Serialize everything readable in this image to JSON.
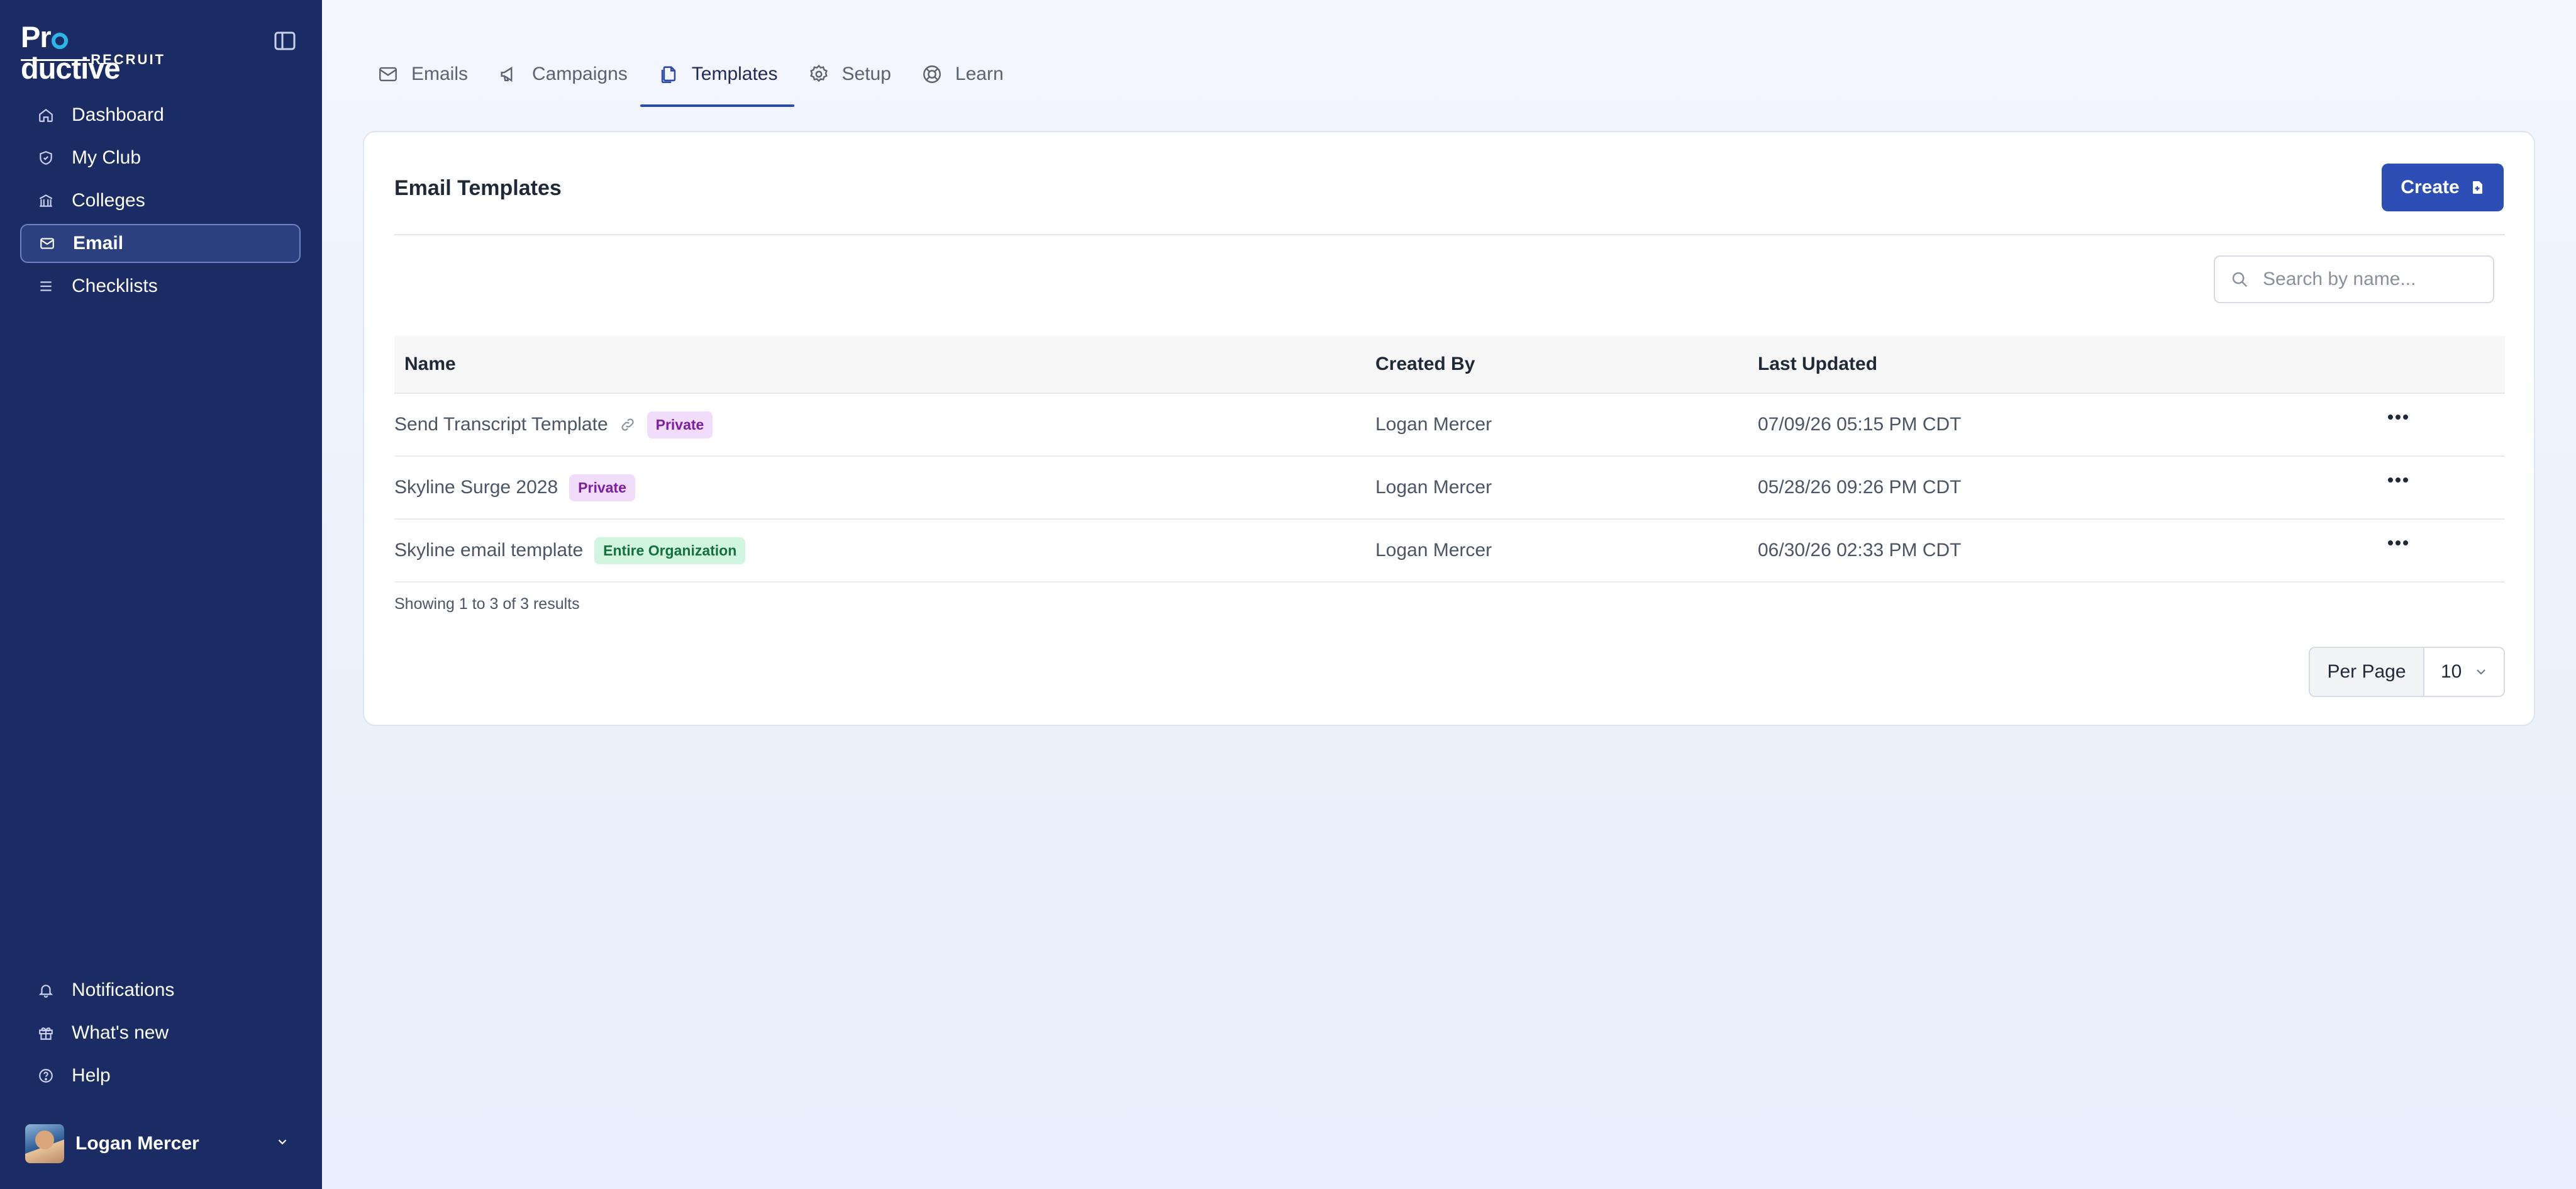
{
  "brand": {
    "name_pre": "Pr",
    "name_post": "ductive",
    "sub": "RECRUIT"
  },
  "sidebar": {
    "items": [
      {
        "label": "Dashboard",
        "icon": "home-icon"
      },
      {
        "label": "My Club",
        "icon": "shield-icon"
      },
      {
        "label": "Colleges",
        "icon": "building-icon"
      },
      {
        "label": "Email",
        "icon": "mail-icon",
        "active": true
      },
      {
        "label": "Checklists",
        "icon": "list-icon"
      }
    ],
    "bottom_items": [
      {
        "label": "Notifications",
        "icon": "bell-icon"
      },
      {
        "label": "What's new",
        "icon": "gift-icon"
      },
      {
        "label": "Help",
        "icon": "help-icon"
      }
    ],
    "user": {
      "name": "Logan Mercer"
    }
  },
  "tabs": [
    {
      "label": "Emails",
      "icon": "mail-icon"
    },
    {
      "label": "Campaigns",
      "icon": "megaphone-icon"
    },
    {
      "label": "Templates",
      "icon": "copy-icon",
      "active": true
    },
    {
      "label": "Setup",
      "icon": "gear-icon"
    },
    {
      "label": "Learn",
      "icon": "lifebuoy-icon"
    }
  ],
  "card": {
    "title": "Email Templates",
    "create_label": "Create",
    "search_placeholder": "Search by name..."
  },
  "table": {
    "headers": {
      "name": "Name",
      "created_by": "Created By",
      "last_updated": "Last Updated"
    },
    "rows": [
      {
        "name": "Send Transcript Template",
        "linked": true,
        "badge": "Private",
        "badge_type": "private",
        "created_by": "Logan Mercer",
        "last_updated": "07/09/26 05:15 PM CDT"
      },
      {
        "name": "Skyline Surge 2028",
        "linked": false,
        "badge": "Private",
        "badge_type": "private",
        "created_by": "Logan Mercer",
        "last_updated": "05/28/26 09:26 PM CDT"
      },
      {
        "name": "Skyline email template",
        "linked": false,
        "badge": "Entire Organization",
        "badge_type": "org",
        "created_by": "Logan Mercer",
        "last_updated": "06/30/26 02:33 PM CDT"
      }
    ],
    "showing": "Showing 1 to 3 of 3 results"
  },
  "pagination": {
    "per_page_label": "Per Page",
    "per_page_value": "10"
  },
  "colors": {
    "sidebar": "#1b2b63",
    "accent": "#2d4fb5",
    "private_badge": "#f1dcfb",
    "org_badge": "#d2f5df"
  }
}
